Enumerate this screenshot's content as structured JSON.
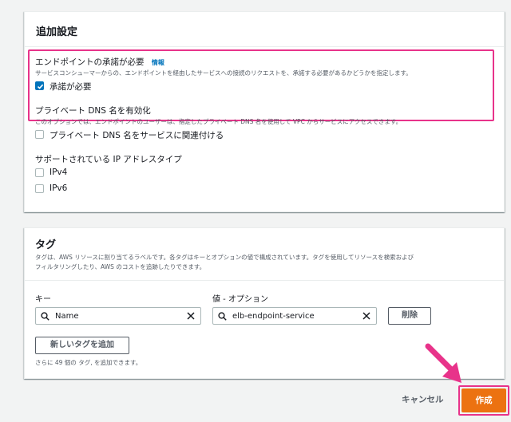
{
  "additional": {
    "title": "追加設定",
    "acceptance": {
      "label": "エンドポイントの承諾が必要",
      "info": "情報",
      "description": "サービスコンシューマーからの、エンドポイントを経由したサービスへの接続のリクエストを、承諾する必要があるかどうかを指定します。",
      "checkbox_label": "承諾が必要",
      "checked": true
    },
    "private_dns": {
      "label": "プライベート DNS 名を有効化",
      "description": "このオプションでは、エンドポイントのユーザーは、指定したプライベート DNS 名を使用して VPC からサービスにアクセスできます。",
      "checkbox_label": "プライベート DNS 名をサービスに関連付ける",
      "checked": false
    },
    "ip_types": {
      "label": "サポートされている IP アドレスタイプ",
      "options": [
        "IPv4",
        "IPv6"
      ]
    }
  },
  "tags": {
    "title": "タグ",
    "description_line1": "タグは、AWS リソースに割り当てるラベルです。各タグはキーとオプションの値で構成されています。タグを使用してリソースを検索および",
    "description_line2": "フィルタリングしたり、AWS のコストを追跡したりできます。",
    "key_label": "キー",
    "value_label": "値 - オプション",
    "key_value": "Name",
    "value_value": "elb-endpoint-service",
    "remove_label": "削除",
    "add_label": "新しいタグを追加",
    "remaining_hint": "さらに 49 個の タグ, を追加できます。"
  },
  "footer": {
    "cancel_label": "キャンセル",
    "create_label": "作成"
  },
  "colors": {
    "primary": "#ec7211",
    "link": "#0073bb",
    "highlight": "#e8338a"
  },
  "icons": [
    "search-icon",
    "clear-icon",
    "check-icon",
    "pointer-arrow-icon"
  ]
}
